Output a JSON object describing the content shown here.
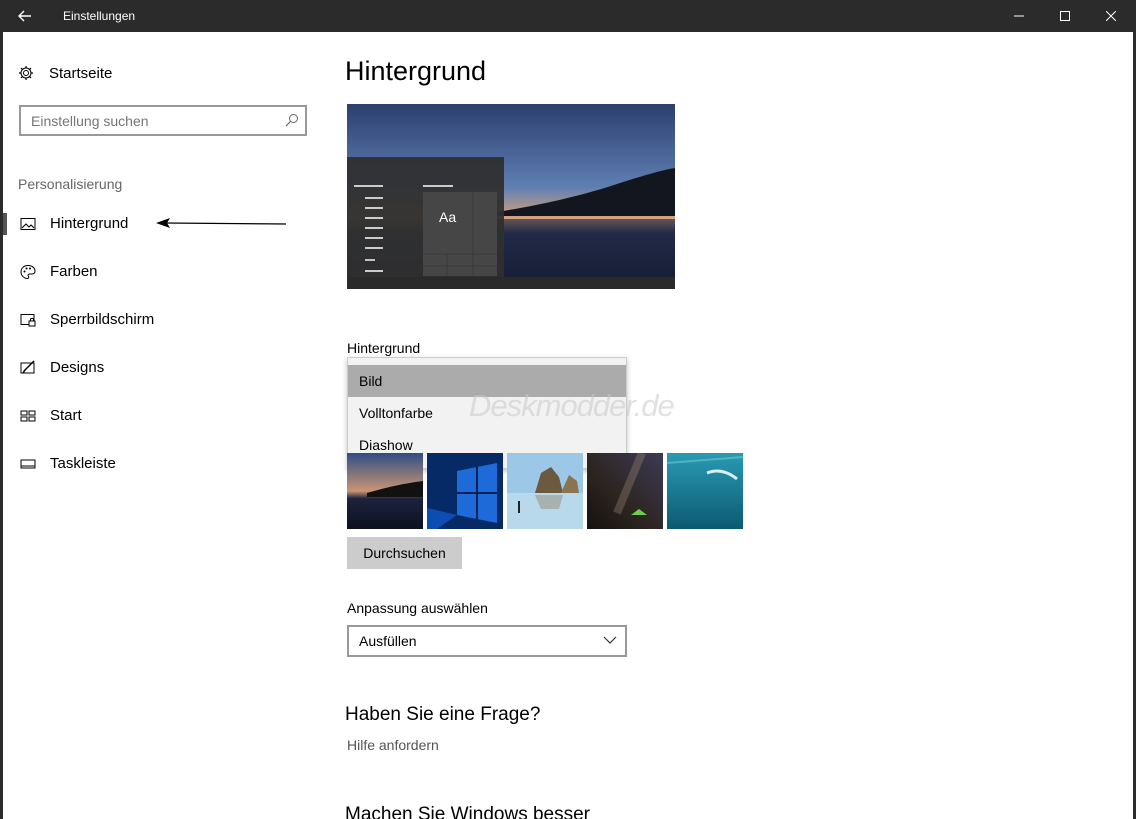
{
  "window": {
    "title": "Einstellungen"
  },
  "sidebar": {
    "home_label": "Startseite",
    "search_placeholder": "Einstellung suchen",
    "section": "Personalisierung",
    "items": [
      {
        "label": "Hintergrund",
        "icon": "picture-icon",
        "active": true
      },
      {
        "label": "Farben",
        "icon": "palette-icon",
        "active": false
      },
      {
        "label": "Sperrbildschirm",
        "icon": "lock-screen-icon",
        "active": false
      },
      {
        "label": "Designs",
        "icon": "designs-icon",
        "active": false
      },
      {
        "label": "Start",
        "icon": "start-tiles-icon",
        "active": false
      },
      {
        "label": "Taskleiste",
        "icon": "taskbar-icon",
        "active": false
      }
    ]
  },
  "main": {
    "title": "Hintergrund",
    "preview": {
      "tile_label": "Aa"
    },
    "background_label": "Hintergrund",
    "background_options": [
      "Bild",
      "Volltonfarbe",
      "Diashow"
    ],
    "background_selected": "Bild",
    "watermark": "Deskmodder.de",
    "browse_label": "Durchsuchen",
    "fit_label": "Anpassung auswählen",
    "fit_value": "Ausfüllen",
    "question_heading": "Haben Sie eine Frage?",
    "help_link": "Hilfe anfordern",
    "improve_heading": "Machen Sie Windows besser"
  },
  "colors": {
    "titlebar": "#2b2b2b",
    "selected_option": "#ababab",
    "button": "#cccccc"
  }
}
